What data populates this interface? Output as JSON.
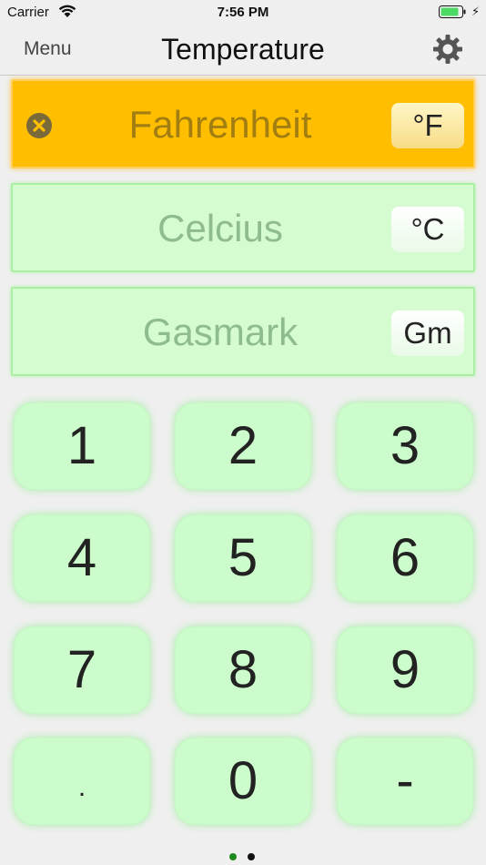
{
  "status": {
    "carrier": "Carrier",
    "time": "7:56 PM"
  },
  "nav": {
    "menu_label": "Menu",
    "title": "Temperature"
  },
  "units": [
    {
      "name": "Fahrenheit",
      "symbol": "°F",
      "active": true
    },
    {
      "name": "Celcius",
      "symbol": "°C",
      "active": false
    },
    {
      "name": "Gasmark",
      "symbol": "Gm",
      "active": false
    }
  ],
  "keypad": [
    "1",
    "2",
    "3",
    "4",
    "5",
    "6",
    "7",
    "8",
    "9",
    ".",
    "0",
    "-"
  ],
  "pager": {
    "pages": 2,
    "current": 1
  },
  "colors": {
    "active_row": "#ffbe00",
    "idle_row": "#d4fcd0",
    "key_bg": "#ccfccc",
    "pager_active": "#1e8a1e",
    "pager_inactive": "#111111"
  }
}
